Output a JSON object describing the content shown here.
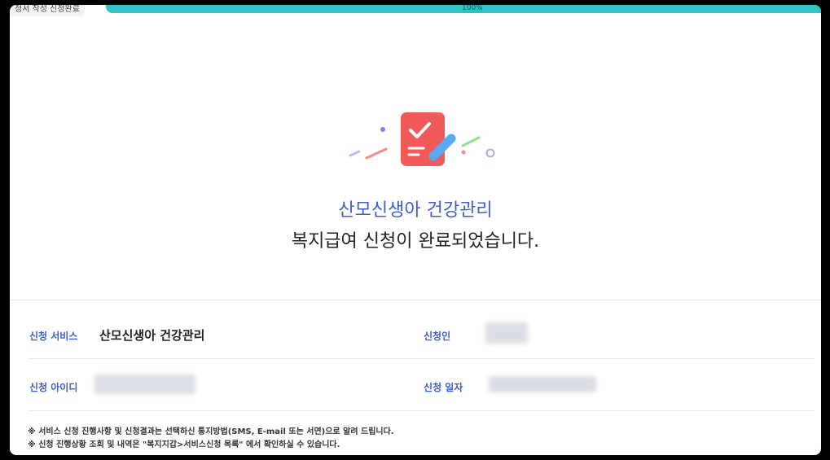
{
  "header": {
    "step_label": "청서 작성 신청완료",
    "progress_text": "100%",
    "progress": 1.0
  },
  "result": {
    "service_title": "산모신생아 건강관리",
    "message": "복지급여 신청이 완료되었습니다."
  },
  "details": {
    "service_label": "신청 서비스",
    "service_value": "산모신생아 건강관리",
    "applicant_label": "신청인",
    "user_id_label": "신청 아이디",
    "date_label": "신청 일자"
  },
  "notes": [
    "※ 서비스 신청 진행사항 및 신청결과는 선택하신 통지방법(SMS, E-mail 또는 서면)으로 알려 드립니다.",
    "※ 신청 진행상황 조회 및 내역은 \"복지지갑>서비스신청 목록\" 에서 확인하실 수 있습니다."
  ],
  "colors": {
    "accent": "#3d5fd0",
    "progress": "#2fc4c6",
    "icon_red": "#f25a5a",
    "icon_pen": "#5aa8f0"
  },
  "icons": {
    "hero": "checklist-pen-icon"
  }
}
